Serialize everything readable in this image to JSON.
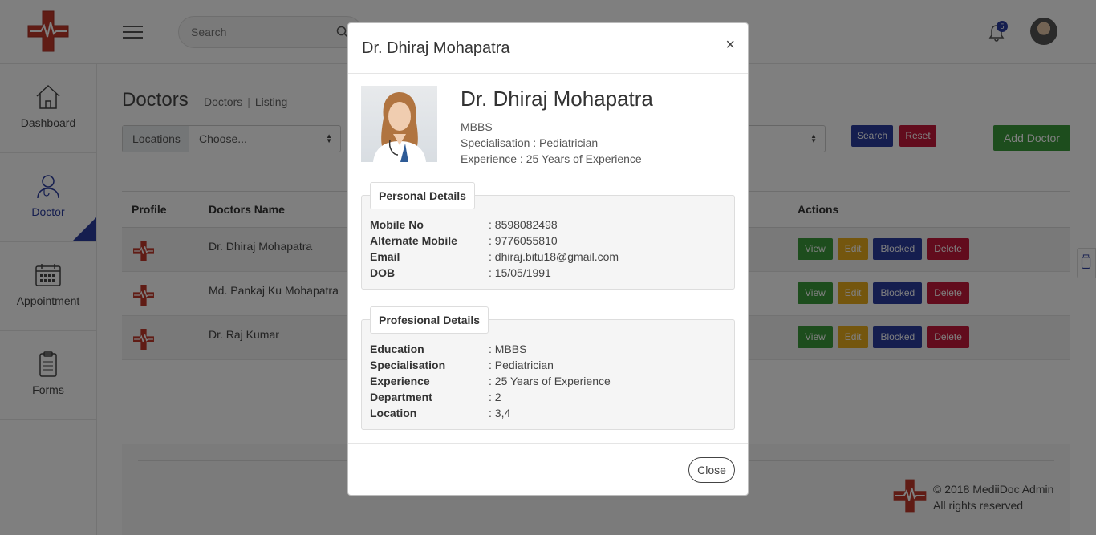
{
  "header": {
    "search_placeholder": "Search",
    "notification_count": "5"
  },
  "sidebar": {
    "items": [
      {
        "label": "Dashboard"
      },
      {
        "label": "Doctor"
      },
      {
        "label": "Appointment"
      },
      {
        "label": "Forms"
      }
    ]
  },
  "page": {
    "title": "Doctors",
    "breadcrumb": [
      "Doctors",
      "Listing"
    ],
    "filter_label": "Locations",
    "filter_value": "Choose...",
    "search_button": "Search",
    "reset_button": "Reset",
    "add_button": "Add Doctor"
  },
  "table": {
    "headers": [
      "Profile",
      "Doctors Name",
      "Actions"
    ],
    "rows": [
      {
        "name": "Dr. Dhiraj Mohapatra"
      },
      {
        "name": "Md. Pankaj Ku Mohapatra"
      },
      {
        "name": "Dr. Raj Kumar"
      }
    ],
    "actions": [
      "View",
      "Edit",
      "Blocked",
      "Delete"
    ]
  },
  "footer": {
    "copyright": "© 2018 MediiDoc Admin",
    "rights": "All rights reserved"
  },
  "modal": {
    "title": "Dr. Dhiraj Mohapatra",
    "close_x": "×",
    "name": "Dr. Dhiraj Mohapatra",
    "qualification": "MBBS",
    "specialisation": "Specialisation : Pediatrician",
    "experience": "Experience : 25 Years of Experience",
    "personal": {
      "legend": "Personal Details",
      "rows": [
        {
          "k": "Mobile No",
          "v": ": 8598082498"
        },
        {
          "k": "Alternate Mobile",
          "v": ": 9776055810"
        },
        {
          "k": "Email",
          "v": ": dhiraj.bitu18@gmail.com"
        },
        {
          "k": "DOB",
          "v": ": 15/05/1991"
        }
      ]
    },
    "professional": {
      "legend": "Profesional Details",
      "rows": [
        {
          "k": "Education",
          "v": ": MBBS"
        },
        {
          "k": "Specialisation",
          "v": ": Pediatrician"
        },
        {
          "k": "Experience",
          "v": ": 25 Years of Experience"
        },
        {
          "k": "Department",
          "v": ": 2"
        },
        {
          "k": "Location",
          "v": ": 3,4"
        }
      ]
    },
    "close_button": "Close"
  },
  "colors": {
    "brand_red": "#c0392b",
    "primary_blue": "#2a3c9f",
    "success_green": "#3a9a3a",
    "warning_yellow": "#e8ac1c",
    "danger_red": "#c5193b"
  }
}
